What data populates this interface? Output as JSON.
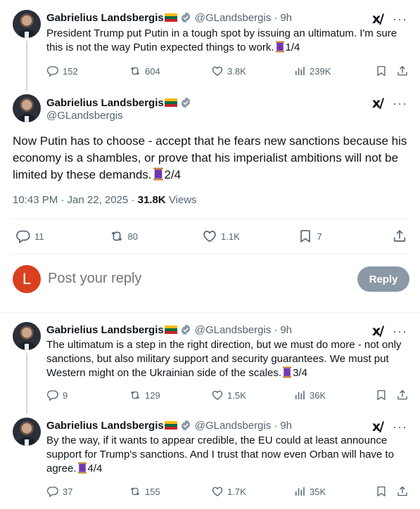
{
  "colors": {
    "accent": "#1d9bf0",
    "text": "#0f1419",
    "muted": "#536471",
    "reply_avatar": "#d9401f",
    "reply_button": "#8b98a5"
  },
  "tweets": [
    {
      "name": "Gabrielius Landsbergis",
      "handle": "@GLandsbergis",
      "time": "9h",
      "text_before": "President Trump put Putin in a tough spot by issuing an ultimatum. I'm sure this is not the way Putin expected things to work.",
      "text_after": "1/4",
      "replies": "152",
      "reposts": "604",
      "likes": "3.8K",
      "views": "239K"
    },
    {
      "name": "Gabrielius Landsbergis",
      "handle": "@GLandsbergis",
      "text_before": "The ultimatum is a step in the right direction, but we must do more - not only sanctions, but also military support and security guarantees. We must put Western might on the Ukrainian side of the scales.",
      "text_after": "3/4",
      "time": "9h",
      "replies": "9",
      "reposts": "129",
      "likes": "1.5K",
      "views": "36K"
    },
    {
      "name": "Gabrielius Landsbergis",
      "handle": "@GLandsbergis",
      "time": "9h",
      "text_before": "By the way, if it wants to appear credible, the EU could at least announce support for Trump's sanctions. And I trust that now even Orban will have to agree.",
      "text_after": "4/4",
      "replies": "37",
      "reposts": "155",
      "likes": "1.7K",
      "views": "35K"
    }
  ],
  "main_tweet": {
    "name": "Gabrielius Landsbergis",
    "handle": "@GLandsbergis",
    "text_before": "Now Putin has to choose - accept that he fears new sanctions because his economy is a shambles, or prove that his imperialist ambitions will not be limited by these demands.",
    "text_after": "2/4",
    "timestamp": "10:43 PM · Jan 22, 2025 ·",
    "views_count": "31.8K",
    "views_label": "Views",
    "replies": "11",
    "reposts": "80",
    "likes": "1.1K",
    "bookmarks": "7"
  },
  "reply_box": {
    "avatar_letter": "L",
    "placeholder": "Post your reply",
    "button_label": "Reply"
  },
  "icons": {
    "flag": "lithuania-flag-icon",
    "verified": "verified-badge-icon",
    "grok": "grok-icon",
    "more": "more-icon",
    "reply": "reply-icon",
    "repost": "repost-icon",
    "like": "like-icon",
    "views": "views-icon",
    "bookmark": "bookmark-icon",
    "share": "share-icon",
    "thread": "spool-of-thread-icon"
  },
  "glyphs": {
    "grok": "x/",
    "more": "···",
    "separator": "·"
  }
}
